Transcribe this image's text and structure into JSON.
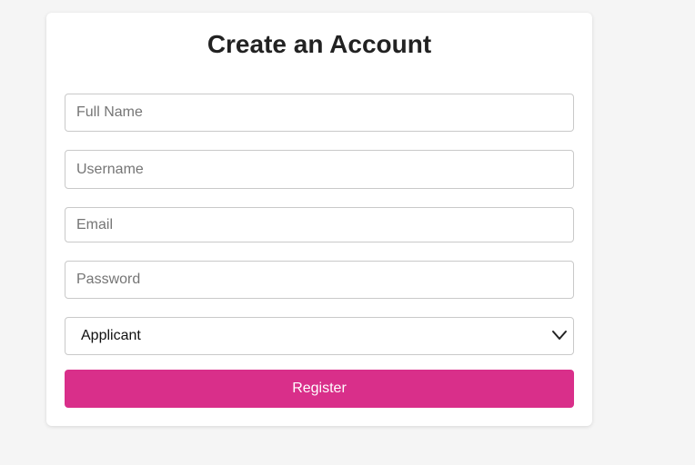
{
  "form": {
    "title": "Create an Account",
    "full_name": {
      "placeholder": "Full Name",
      "value": ""
    },
    "username": {
      "placeholder": "Username",
      "value": ""
    },
    "email": {
      "placeholder": "Email",
      "value": ""
    },
    "password": {
      "placeholder": "Password",
      "value": ""
    },
    "role_select": {
      "selected": "Applicant",
      "icon": "chevron-down-icon"
    },
    "register_label": "Register"
  },
  "colors": {
    "page_background": "#f5f5f5",
    "card_background": "#ffffff",
    "accent": "#d92f8a",
    "border": "#c9c9c9"
  }
}
